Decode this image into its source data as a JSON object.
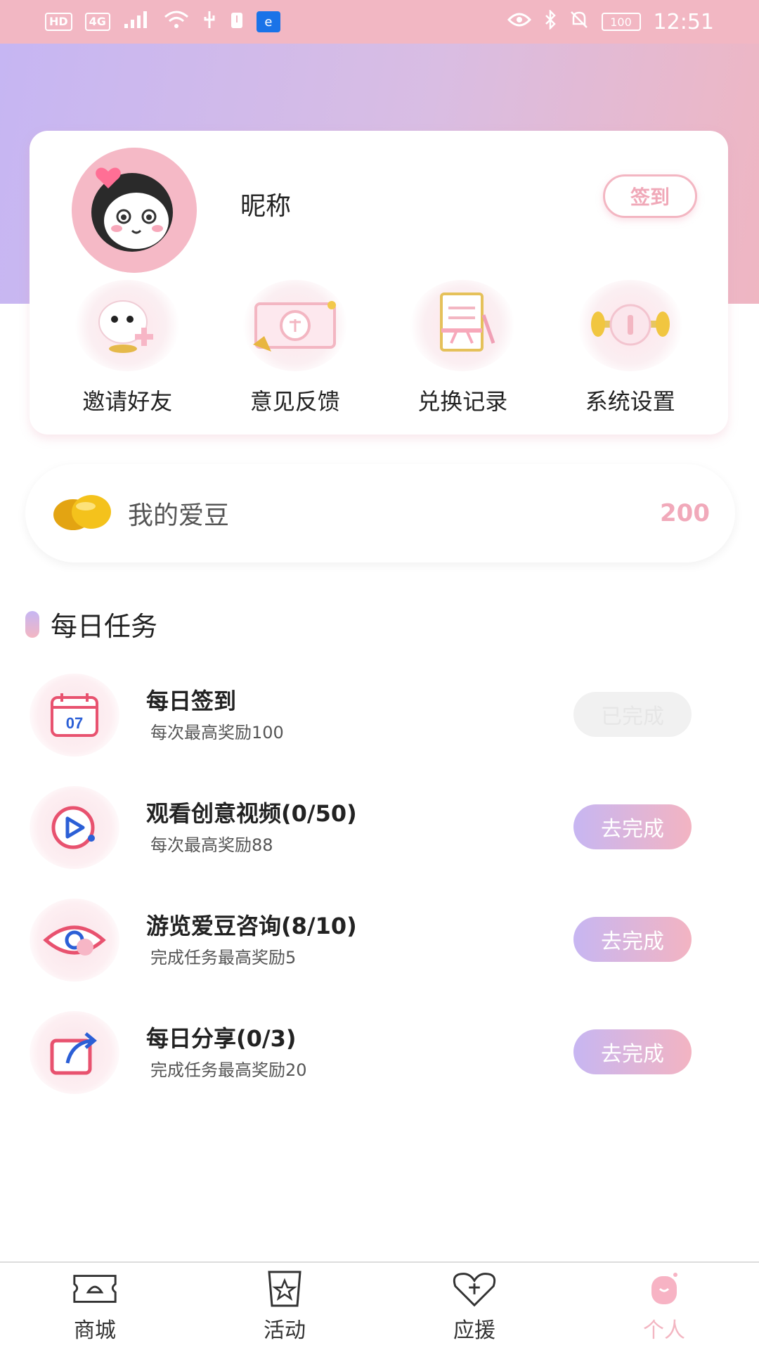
{
  "status_bar": {
    "left_chips": [
      "HD",
      "4G"
    ],
    "time": "12:51",
    "battery": "100"
  },
  "profile": {
    "nickname": "昵称",
    "signin_label": "签到"
  },
  "features": [
    {
      "label": "邀请好友",
      "icon": "invite-ghost-icon"
    },
    {
      "label": "意见反馈",
      "icon": "feedback-ticket-icon"
    },
    {
      "label": "兑换记录",
      "icon": "exchange-record-icon"
    },
    {
      "label": "系统设置",
      "icon": "settings-dumbbell-icon"
    }
  ],
  "beans": {
    "label": "我的爱豆",
    "value": "200"
  },
  "daily_tasks": {
    "title": "每日任务",
    "items": [
      {
        "title": "每日签到",
        "desc": "每次最高奖励100",
        "button": "已完成",
        "done": true,
        "icon": "calendar-icon",
        "icon_text": "07"
      },
      {
        "title": "观看创意视频(0/50)",
        "desc": "每次最高奖励88",
        "button": "去完成",
        "done": false,
        "icon": "play-video-icon"
      },
      {
        "title": "游览爱豆咨询(8/10)",
        "desc": "完成任务最高奖励5",
        "button": "去完成",
        "done": false,
        "icon": "eye-icon"
      },
      {
        "title": "每日分享(0/3)",
        "desc": "完成任务最高奖励20",
        "button": "去完成",
        "done": false,
        "icon": "share-icon"
      }
    ]
  },
  "bottom_nav": [
    {
      "label": "商城",
      "icon": "mall-ticket-icon"
    },
    {
      "label": "活动",
      "icon": "activity-star-icon"
    },
    {
      "label": "应援",
      "icon": "support-heart-icon"
    },
    {
      "label": "个人",
      "icon": "profile-ghost-icon",
      "active": true
    }
  ],
  "colors": {
    "accent_pink": "#f3b6c2",
    "accent_purple": "#c6b6f3",
    "brand_red": "#e8526f"
  }
}
